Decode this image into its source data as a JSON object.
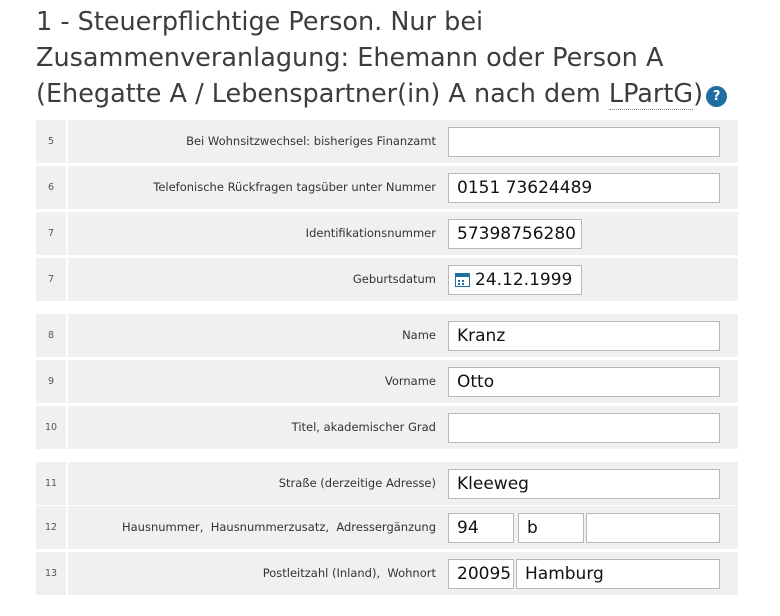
{
  "heading": {
    "text": "1 - Steuerpflichtige Person. Nur bei Zusammenveranlagung: Ehemann oder Person A (Ehegatte A / Lebenspartner(in) A nach dem ",
    "abbr": "LPartG",
    "suffix": ")",
    "help_glyph": "?",
    "help_icon": "help-icon"
  },
  "rows": [
    {
      "num": "5",
      "label": "Bei Wohnsitzwechsel: bisheriges Finanzamt",
      "value": ""
    },
    {
      "num": "6",
      "label": "Telefonische Rückfragen tagsüber unter Nummer",
      "value": "0151 73624489"
    },
    {
      "num": "7",
      "label": "Identifikationsnummer",
      "value": "57398756280"
    },
    {
      "num": "7",
      "label": "Geburtsdatum",
      "value": "24.12.1999",
      "icon": "calendar-icon"
    },
    {
      "num": "8",
      "label": "Name",
      "value": "Kranz"
    },
    {
      "num": "9",
      "label": "Vorname",
      "value": "Otto"
    },
    {
      "num": "10",
      "label": "Titel, akademischer Grad",
      "value": ""
    },
    {
      "num": "11",
      "label": "Straße (derzeitige Adresse)",
      "value": "Kleeweg"
    },
    {
      "num": "12",
      "label": "Hausnummer,  Hausnummerzusatz,  Adressergänzung",
      "values": [
        "94",
        "b",
        ""
      ]
    },
    {
      "num": "13",
      "label": "Postleitzahl (Inland),  Wohnort",
      "values": [
        "20095",
        "Hamburg"
      ]
    }
  ],
  "colors": {
    "row_background": "#f0f0f0",
    "accent": "#1e6fa0",
    "heading_text": "#3d3d3d"
  }
}
